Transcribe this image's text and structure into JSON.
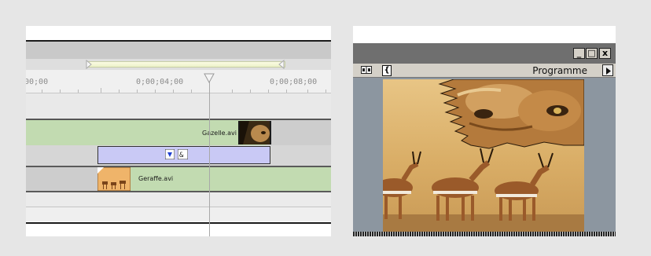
{
  "timeline": {
    "timecodes": [
      "00;00",
      "0;00;04;00",
      "0;00;08;00"
    ],
    "clips": {
      "gazelle": {
        "label": "Gazelle.avi"
      },
      "geraffe": {
        "label": "Geraffe.avi"
      }
    }
  },
  "monitor": {
    "title": "Programme",
    "window_buttons": {
      "minimize": "_",
      "maximize": "□",
      "close": "x"
    },
    "bracket_button": "{"
  },
  "icons": {
    "timecode_bracket": "{",
    "transition": "transition-icon",
    "marker": "marker-icon"
  },
  "colors": {
    "track_green": "#c2dbb1",
    "transition_blue": "#c9c9f5",
    "desktop_gray": "#e6e6e6"
  }
}
